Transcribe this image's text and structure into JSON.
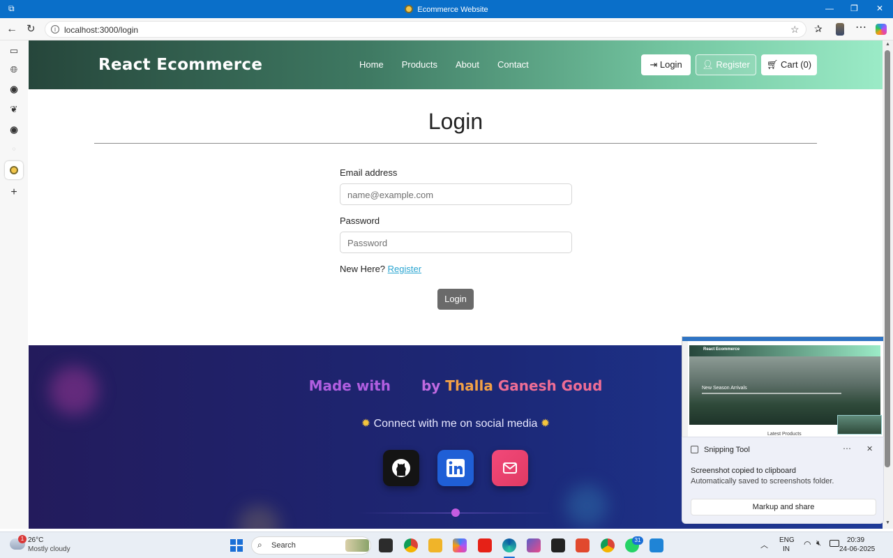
{
  "window": {
    "title": "Ecommerce Website",
    "url": "localhost:3000/login"
  },
  "navbar": {
    "brand": "React Ecommerce",
    "links": [
      "Home",
      "Products",
      "About",
      "Contact"
    ],
    "login_label": "Login",
    "register_label": "Register",
    "cart_label": "Cart (0)"
  },
  "login_form": {
    "heading": "Login",
    "email_label": "Email address",
    "email_placeholder": "name@example.com",
    "password_label": "Password",
    "password_placeholder": "Password",
    "new_here_text": "New Here?",
    "register_link": "Register",
    "submit_label": "Login"
  },
  "footer": {
    "made_with": "Made with",
    "by": "by",
    "author_first": "Thalla",
    "author_rest": "Ganesh Goud",
    "connect_text": "Connect with me on social media",
    "social": [
      "github-icon",
      "linkedin-icon",
      "mail-icon"
    ]
  },
  "snipping_tool": {
    "app_name": "Snipping Tool",
    "message": "Screenshot copied to clipboard",
    "submessage": "Automatically saved to screenshots folder.",
    "button": "Markup and share",
    "preview": {
      "brand": "React Ecommerce",
      "banner_title": "New Season Arrivals",
      "section_title": "Latest Products"
    }
  },
  "taskbar": {
    "weather_temp": "26°C",
    "weather_desc": "Mostly cloudy",
    "weather_badge": "1",
    "search_placeholder": "Search",
    "lang_1": "ENG",
    "lang_2": "IN",
    "time": "20:39",
    "date": "24-06-2025",
    "notif_badge_1": "31"
  },
  "colors": {
    "titlebar": "#0a6fc9",
    "navbar_start": "#26463b",
    "navbar_end": "#9bebc7",
    "footer_start": "#231b5c",
    "footer_end": "#1e3a98",
    "link": "#2aa5d1"
  }
}
